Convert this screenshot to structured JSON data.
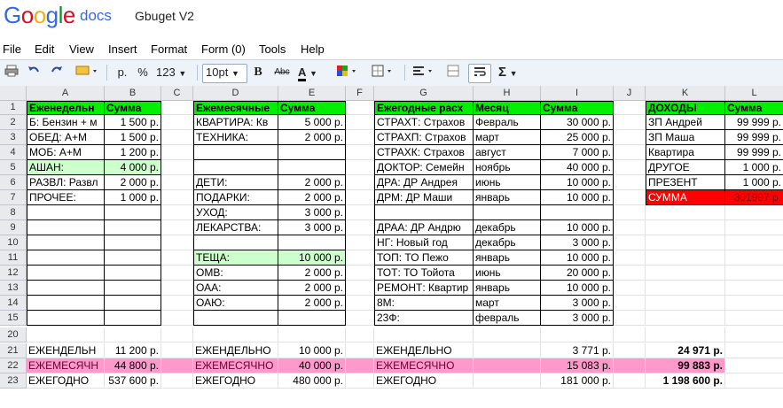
{
  "app": {
    "logo": "Google",
    "product": "docs",
    "doc_title": "Gbuget V2"
  },
  "menu": [
    "File",
    "Edit",
    "View",
    "Insert",
    "Format",
    "Form (0)",
    "Tools",
    "Help"
  ],
  "toolbar": {
    "currency": "p.",
    "percent": "%",
    "number_format": "123",
    "font_size": "10pt",
    "bold": "B",
    "strike": "Abc",
    "text_color": "A",
    "sum": "Σ"
  },
  "columns": [
    "A",
    "B",
    "C",
    "D",
    "E",
    "F",
    "G",
    "H",
    "I",
    "J",
    "K",
    "L"
  ],
  "rows": [
    "1",
    "2",
    "3",
    "4",
    "5",
    "6",
    "7",
    "8",
    "9",
    "10",
    "11",
    "12",
    "13",
    "14",
    "15",
    "20",
    "21",
    "22",
    "23"
  ],
  "cells": {
    "A1": "Еженедельн",
    "B1": "Сумма",
    "D1": "Ежемесячные",
    "E1": "Сумма",
    "G1": "Ежегодные расх",
    "H1": "Месяц",
    "I1": "Сумма",
    "K1": "ДОХОДЫ",
    "L1": "Сумма",
    "A2": "Б: Бензин + м",
    "B2": "1 500 р.",
    "D2": "КВАРТИРА: Кв",
    "E2": "5 000 р.",
    "G2": "СТРАХТ: Страхов",
    "H2": "Февраль",
    "I2": "30 000 р.",
    "K2": "ЗП Андрей",
    "L2": "99 999 р.",
    "A3": "ОБЕД: А+М",
    "B3": "1 500 р.",
    "D3": "ТЕХНИКА:",
    "E3": "2 000 р.",
    "G3": "СТРАХП: Страхов",
    "H3": "март",
    "I3": "25 000 р.",
    "K3": "ЗП Маша",
    "L3": "99 999 р.",
    "A4": "МОБ: А+М",
    "B4": "1 200 р.",
    "G4": "СТРАХК: Страхов",
    "H4": "август",
    "I4": "7 000 р.",
    "K4": "Квартира",
    "L4": "99 999 р.",
    "A5": "АШАН:",
    "B5": "4 000 р.",
    "G5": "ДОКТОР: Семейн",
    "H5": "ноябрь",
    "I5": "40 000 р.",
    "K5": "ДРУГОЕ",
    "L5": "1 000 р.",
    "A6": "РАЗВЛ: Развл",
    "B6": "2 000 р.",
    "D6": "ДЕТИ:",
    "E6": "2 000 р.",
    "G6": "ДРА: ДР Андрея",
    "H6": "июнь",
    "I6": "10 000 р.",
    "K6": "ПРЕЗЕНТ",
    "L6": "1 000 р.",
    "A7": "ПРОЧЕЕ:",
    "B7": "1 000 р.",
    "D7": "ПОДАРКИ:",
    "E7": "2 000 р.",
    "G7": "ДРМ: ДР Маши",
    "H7": "январь",
    "I7": "10 000 р.",
    "K7": "СУММА",
    "L7": "301997 р.",
    "D8": "УХОД:",
    "E8": "3 000 р.",
    "D9": "ЛЕКАРСТВА:",
    "E9": "3 000 р.",
    "G9": "ДРАА: ДР Андрю",
    "H9": "декабрь",
    "I9": "10 000 р.",
    "G10": "НГ: Новый год",
    "H10": "декабрь",
    "I10": "3 000 р.",
    "D11": "ТЕЩА:",
    "E11": "10 000 р.",
    "G11": "ТОП: ТО Пежо",
    "H11": "январь",
    "I11": "10 000 р.",
    "D12": "ОМВ:",
    "E12": "2 000 р.",
    "G12": "ТОТ: ТО Тойота",
    "H12": "июнь",
    "I12": "20 000 р.",
    "D13": "ОАА:",
    "E13": "2 000 р.",
    "G13": "РЕМОНТ: Квартир",
    "H13": "январь",
    "I13": "10 000 р.",
    "D14": "ОАЮ:",
    "E14": "2 000 р.",
    "G14": "8М:",
    "H14": "март",
    "I14": "3 000 р.",
    "G15": "23Ф:",
    "H15": "февраль",
    "I15": "3 000 р.",
    "A21": "ЕЖЕНДЕЛЬН",
    "B21": "11 200 р.",
    "D21": "ЕЖЕНДЕЛЬНО",
    "E21": "10 000 р.",
    "G21": "ЕЖЕНДЕЛЬНО",
    "I21": "3 771 р.",
    "K21": "24 971 р.",
    "A22": "ЕЖЕМЕСЯЧН",
    "B22": "44 800 р.",
    "D22": "ЕЖЕМЕСЯЧНО",
    "E22": "40 000 р.",
    "G22": "ЕЖЕМЕСЯЧНО",
    "I22": "15 083 р.",
    "K22": "99 883 р.",
    "A23": "ЕЖЕГОДНО",
    "B23": "537 600 р.",
    "D23": "ЕЖЕГОДНО",
    "E23": "480 000 р.",
    "G23": "ЕЖЕГОДНО",
    "I23": "181 000 р.",
    "K23": "1 198 600 р."
  },
  "colors": {
    "header_green": "#00ee00",
    "light_green": "#ccffcc",
    "red": "#ff0000",
    "pink": "#ff99cc",
    "toolbar_bg": "#eef2f9"
  }
}
